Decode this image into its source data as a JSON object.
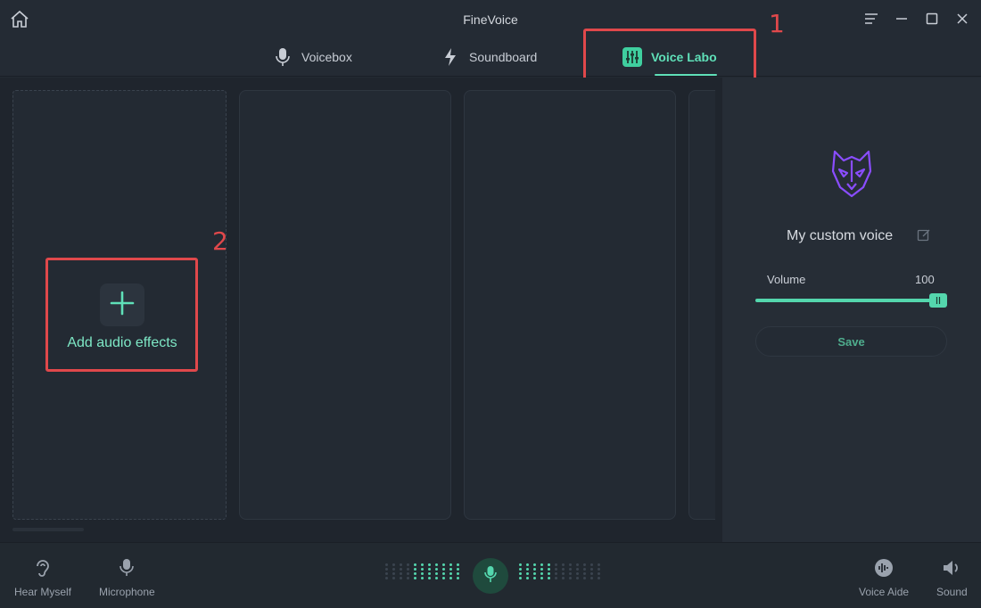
{
  "app": {
    "title": "FineVoice"
  },
  "tabs": [
    {
      "label": "Voicebox",
      "icon": "microphone-icon",
      "active": false
    },
    {
      "label": "Soundboard",
      "icon": "lightning-icon",
      "active": false
    },
    {
      "label": "Voice Labo",
      "icon": "equalizer-icon",
      "active": true
    }
  ],
  "annotations": {
    "one": "1",
    "two": "2"
  },
  "panels": {
    "add_effects_label": "Add audio effects"
  },
  "right_panel": {
    "voice_name": "My custom voice",
    "volume_label": "Volume",
    "volume_value": "100",
    "volume_level": 1.0,
    "save_label": "Save",
    "avatar_icon": "wolf-mask-icon"
  },
  "bottom_bar": {
    "hear_myself": "Hear Myself",
    "microphone": "Microphone",
    "voice_aide": "Voice Aide",
    "sound": "Sound"
  },
  "colors": {
    "accent": "#54d6ad",
    "annotation": "#e0484b",
    "avatar": "#8a4dff"
  }
}
